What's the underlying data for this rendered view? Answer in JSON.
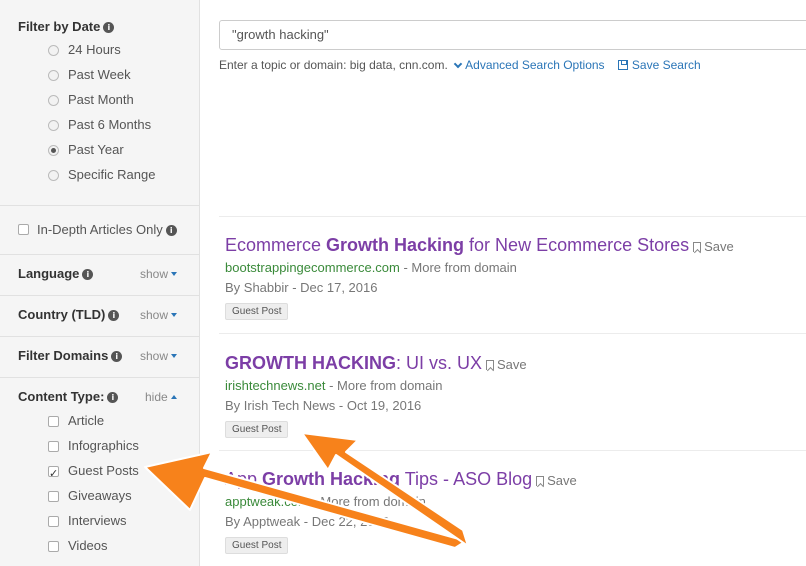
{
  "sidebar": {
    "filter_by_date": {
      "title": "Filter by Date",
      "options": [
        "24 Hours",
        "Past Week",
        "Past Month",
        "Past 6 Months",
        "Past Year",
        "Specific Range"
      ],
      "selected": "Past Year"
    },
    "in_depth": {
      "label": "In-Depth Articles Only",
      "checked": false
    },
    "language": {
      "title": "Language",
      "toggle": "show"
    },
    "country": {
      "title": "Country (TLD)",
      "toggle": "show"
    },
    "domains": {
      "title": "Filter Domains",
      "toggle": "show"
    },
    "content_type": {
      "title": "Content Type:",
      "toggle": "hide",
      "options": [
        {
          "label": "Article",
          "checked": false
        },
        {
          "label": "Infographics",
          "checked": false
        },
        {
          "label": "Guest Posts",
          "checked": true
        },
        {
          "label": "Giveaways",
          "checked": false
        },
        {
          "label": "Interviews",
          "checked": false
        },
        {
          "label": "Videos",
          "checked": false
        }
      ]
    }
  },
  "search": {
    "value": "\"growth hacking\"",
    "hint": "Enter a topic or domain: big data, cnn.com.",
    "advanced_label": "Advanced Search Options",
    "save_label": "Save Search"
  },
  "results": [
    {
      "title_pre": "Ecommerce ",
      "title_bold": "Growth Hacking",
      "title_post": " for New Ecommerce Stores",
      "save": "Save",
      "domain": "bootstrappingecommerce.com",
      "more": " - More from domain",
      "meta": "By Shabbir - Dec 17, 2016",
      "tag": "Guest Post"
    },
    {
      "title_pre": "",
      "title_bold": "GROWTH HACKING",
      "title_post": ": UI vs. UX",
      "save": "Save",
      "domain": "irishtechnews.net",
      "more": " - More from domain",
      "meta": "By Irish Tech News - Oct 19, 2016",
      "tag": "Guest Post"
    },
    {
      "title_pre": "App ",
      "title_bold": "Growth Hacking",
      "title_post": " Tips - ASO Blog",
      "save": "Save",
      "domain": "apptweak.com",
      "more": " - More from domain",
      "meta": "By Apptweak - Dec 22, 2016",
      "tag": "Guest Post"
    }
  ],
  "colors": {
    "link": "#2a75b7",
    "result_title": "#7c3ea6",
    "domain": "#3a8a3a",
    "arrow": "#f7821b"
  }
}
